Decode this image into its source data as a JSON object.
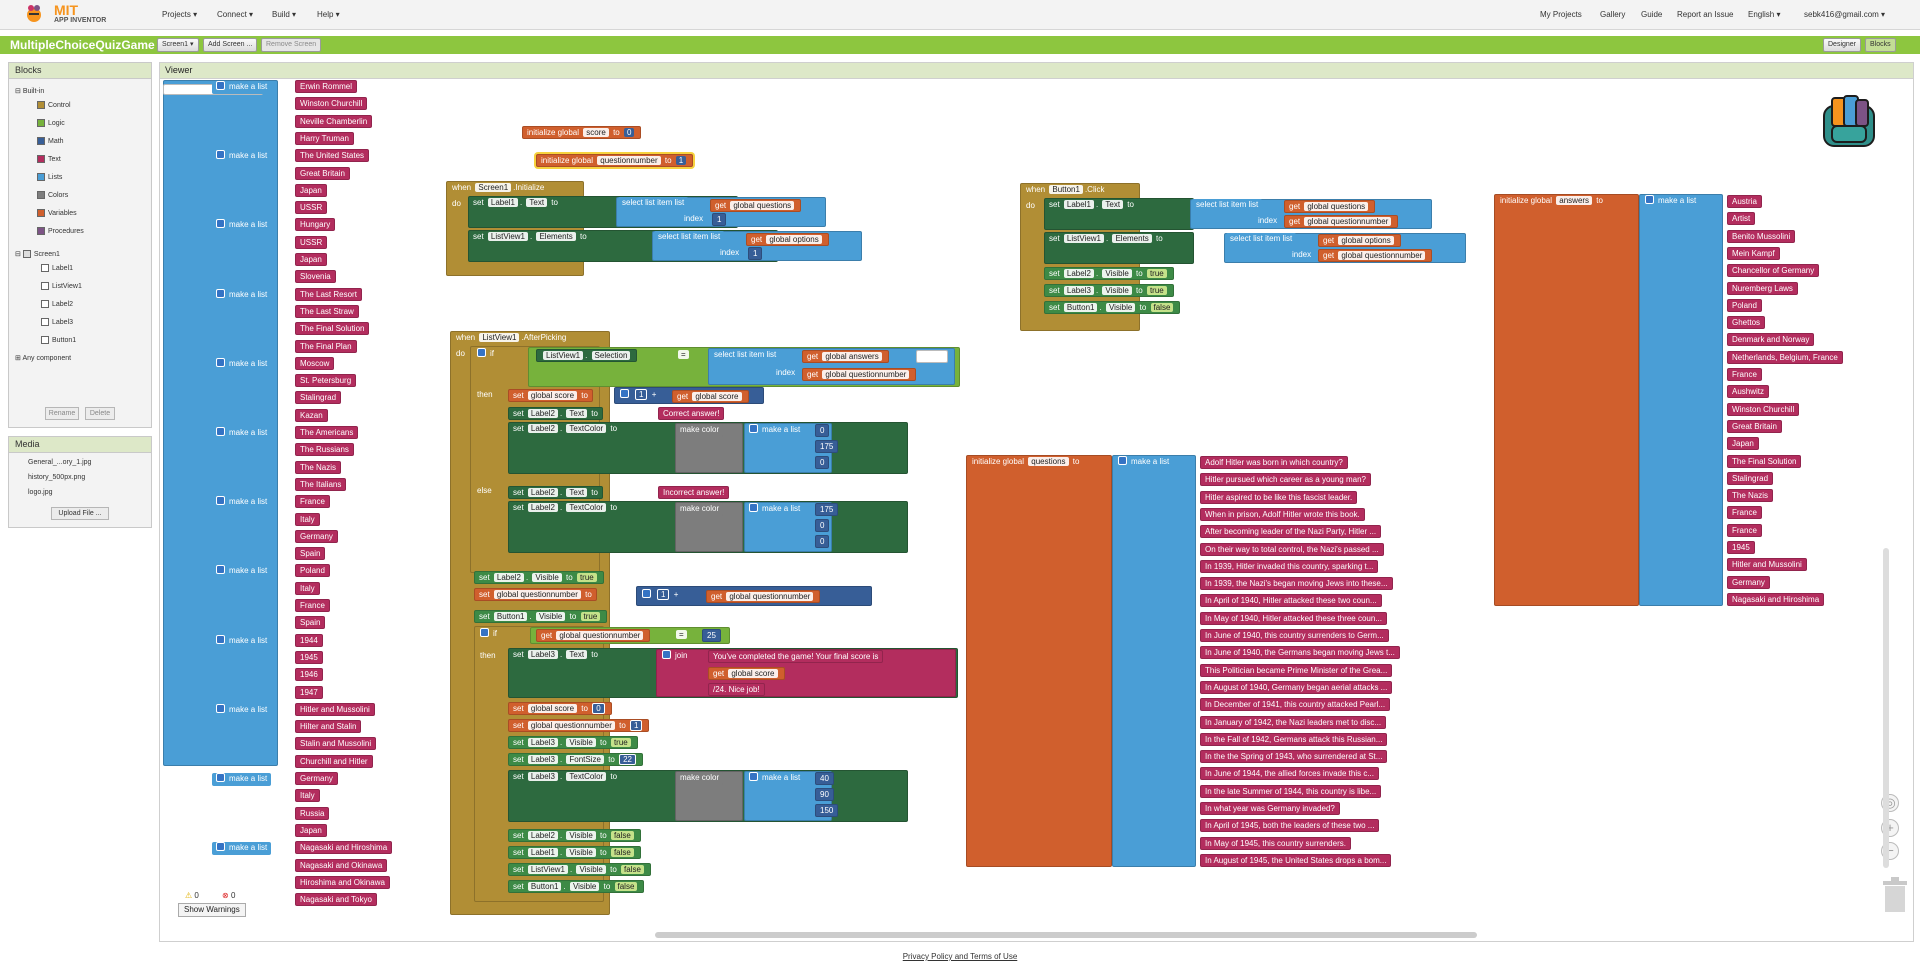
{
  "app": {
    "logo_top": "MIT",
    "logo_bottom": "APP INVENTOR",
    "project_name": "MultipleChoiceQuizGame"
  },
  "menus": {
    "projects": "Projects ▾",
    "connect": "Connect ▾",
    "build": "Build ▾",
    "help": "Help ▾"
  },
  "right_menu": {
    "my_projects": "My Projects",
    "gallery": "Gallery",
    "guide": "Guide",
    "report": "Report an Issue",
    "language": "English ▾",
    "account": "sebk416@gmail.com ▾"
  },
  "toolbar": {
    "screen": "Screen1 ▾",
    "add_screen": "Add Screen ...",
    "remove_screen": "Remove Screen",
    "designer": "Designer",
    "blocks": "Blocks"
  },
  "blocks_panel": {
    "title": "Blocks",
    "builtin": "Built-in",
    "items": [
      "Control",
      "Logic",
      "Math",
      "Text",
      "Lists",
      "Colors",
      "Variables",
      "Procedures"
    ],
    "colors": [
      "#b18e35",
      "#77b23c",
      "#375e97",
      "#b32d5e",
      "#4a9ed6",
      "#7d7d7d",
      "#d05f2d",
      "#7c5385"
    ],
    "screen": "Screen1",
    "components": [
      "Label1",
      "ListView1",
      "Label2",
      "Label3",
      "Button1"
    ],
    "any": "Any component",
    "rename": "Rename",
    "delete": "Delete"
  },
  "media": {
    "title": "Media",
    "files": [
      "General_...ory_1.jpg",
      "history_500px.png",
      "logo.jpg"
    ],
    "upload": "Upload File ..."
  },
  "viewer": {
    "title": "Viewer"
  },
  "left_list": {
    "label": "make a list",
    "groups": [
      [
        "Erwin Rommel",
        "Winston Churchill",
        "Neville Chamberlin",
        "Harry Truman"
      ],
      [
        "The United States",
        "Great Britain",
        "Japan",
        "USSR"
      ],
      [
        "Hungary",
        "USSR",
        "Japan",
        "Slovenia"
      ],
      [
        "The Last Resort",
        "The Last Straw",
        "The Final Solution",
        "The Final Plan"
      ],
      [
        "Moscow",
        "St. Petersburg",
        "Stalingrad",
        "Kazan"
      ],
      [
        "The Americans",
        "The Russians",
        "The Nazis",
        "The Italians"
      ],
      [
        "France",
        "Italy",
        "Germany",
        "Spain"
      ],
      [
        "Poland",
        "Italy",
        "France",
        "Spain"
      ],
      [
        "1944",
        "1945",
        "1946",
        "1947"
      ],
      [
        "Hitler and Mussolini",
        "Hilter and Stalin",
        "Stalin and Mussolini",
        "Churchill and Hitler"
      ],
      [
        "Germany",
        "Italy",
        "Russia",
        "Japan"
      ],
      [
        "Nagasaki and Hiroshima",
        "Nagasaki and Okinawa",
        "Hiroshima and Okinawa",
        "Nagasaki and Tokyo"
      ]
    ]
  },
  "init_score": {
    "label": "initialize global",
    "name": "score",
    "to": "to",
    "value": "0"
  },
  "init_qn": {
    "label": "initialize global",
    "name": "questionnumber",
    "to": "to",
    "value": "1"
  },
  "init_block": {
    "when": "when",
    "component": "Screen1",
    "event": ".Initialize",
    "do": "do",
    "set": "set",
    "label1": "Label1",
    "text": "Text",
    "to": "to",
    "select": "select list item  list",
    "get": "get",
    "questions": "global questions",
    "index": "index",
    "one": "1",
    "listview": "ListView1",
    "elements": "Elements",
    "options": "global options"
  },
  "picking": {
    "when": "when",
    "component": "ListView1",
    "event": ".AfterPicking",
    "do": "do",
    "if": "if",
    "then": "then",
    "else": "else",
    "selection": "Selection",
    "eq": "=",
    "select": "select list item  list",
    "answers": "global answers",
    "index": "index",
    "qn": "global questionnumber",
    "set": "set",
    "to": "to",
    "score": "global score",
    "one": "1",
    "plus": "+",
    "label2": "Label2",
    "label3": "Label3",
    "label1": "Label1",
    "text": "Text",
    "textcolor": "TextColor",
    "visible": "Visible",
    "fontsize": "FontSize",
    "button1": "Button1",
    "listview1": "ListView1",
    "correct": "Correct answer!",
    "incorrect": "Incorrect answer!",
    "make_color": "make color",
    "make_list": "make a list",
    "c1": [
      "0",
      "175",
      "0"
    ],
    "c2": [
      "175",
      "0",
      "0"
    ],
    "c3": [
      "40",
      "90",
      "150"
    ],
    "true": "true",
    "false": "false",
    "n25": "25",
    "join": "join",
    "completed": "You've completed the game! Your final score is",
    "get_score": "global score",
    "nice": "/24. Nice job!",
    "zero": "0",
    "n22": "22"
  },
  "click": {
    "when": "when",
    "component": "Button1",
    "event": ".Click",
    "do": "do",
    "set": "set",
    "to": "to",
    "label1": "Label1",
    "text": "Text",
    "select": "select list item  list",
    "get": "get",
    "questions": "global questions",
    "index": "index",
    "qn": "global questionnumber",
    "listview": "ListView1",
    "elements": "Elements",
    "options": "global options",
    "label2": "Label2",
    "label3": "Label3",
    "button1": "Button1",
    "visible": "Visible",
    "true": "true",
    "false": "false"
  },
  "questions": {
    "label": "initialize global",
    "name": "questions",
    "to": "to",
    "make_list": "make a list",
    "items": [
      "Adolf Hitler was born in which country?",
      "Hitler pursued which career as a young man?",
      "Hitler aspired to be like this fascist leader.",
      "When in prison, Adolf Hitler wrote this book.",
      "After becoming leader of the Nazi Party, Hitler ...",
      "On their way to total control, the Nazi's passed ...",
      "In 1939, Hitler invaded this country, sparking t...",
      "In 1939, the Nazi's began moving Jews into these...",
      "In April of 1940, Hitler attacked these two coun...",
      "In May of 1940, Hitler attacked these three coun...",
      "In June of 1940, this country surrenders to Germ...",
      "In June of 1940, the Germans began moving Jews t...",
      "This Politician became Prime Minister of the Grea...",
      "In August of 1940, Germany began aerial attacks ...",
      "In December of 1941, this country attacked Pearl...",
      "In January of 1942, the Nazi leaders met to disc...",
      "In the Fall of 1942, Germans attack this Russian...",
      "In the the Spring of 1943, who surrendered at St...",
      "In June of 1944, the allied forces invade this c...",
      "In the late Summer of 1944, this country is libe...",
      "In what year was Germany invaded?",
      "In April of 1945, both the leaders of these two ...",
      "In May of 1945, this country surrenders.",
      "In August of 1945, the United States drops a bom..."
    ]
  },
  "answers": {
    "label": "initialize global",
    "name": "answers",
    "to": "to",
    "make_list": "make a list",
    "items": [
      "Austria",
      "Artist",
      "Benito Mussolini",
      "Mein Kampf",
      "Chancellor of Germany",
      "Nuremberg Laws",
      "Poland",
      "Ghettos",
      "Denmark and Norway",
      "Netherlands, Belgium, France",
      "France",
      "Aushwitz",
      "Winston Churchill",
      "Great Britain",
      "Japan",
      "The Final Solution",
      "Stalingrad",
      "The Nazis",
      "France",
      "France",
      "1945",
      "Hitler and Mussolini",
      "Germany",
      "Nagasaki and Hiroshima"
    ]
  },
  "warnings": {
    "warn_count": "0",
    "err_count": "0",
    "show": "Show Warnings"
  },
  "footer": "Privacy Policy and Terms of Use"
}
